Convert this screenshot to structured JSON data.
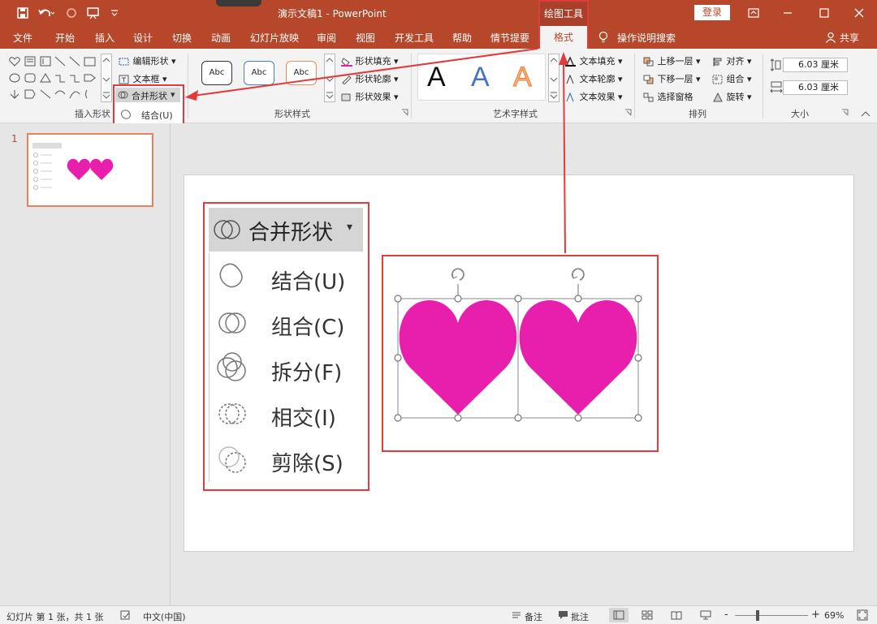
{
  "titlebar": {
    "title": "演示文稿1 - PowerPoint",
    "drawing_tools": "绘图工具",
    "login": "登录"
  },
  "tabs": [
    "文件",
    "开始",
    "插入",
    "设计",
    "切换",
    "动画",
    "幻灯片放映",
    "审阅",
    "视图",
    "开发工具",
    "帮助",
    "情节提要",
    "格式"
  ],
  "tell_me": "操作说明搜索",
  "share": "共享",
  "ribbon": {
    "insert_shapes": {
      "edit_shape": "编辑形状",
      "text_box": "文本框",
      "merge_shapes": "合并形状",
      "label": "插入形状"
    },
    "shape_styles": {
      "sample": "Abc",
      "fill": "形状填充",
      "outline": "形状轮廓",
      "effects": "形状效果",
      "label": "形状样式"
    },
    "wordart": {
      "letter": "A",
      "text_fill": "文本填充",
      "text_outline": "文本轮廓",
      "text_effects": "文本效果",
      "label": "艺术字样式"
    },
    "arrange": {
      "bring_forward": "上移一层",
      "send_backward": "下移一层",
      "selection_pane": "选择窗格",
      "align": "对齐",
      "group": "组合",
      "rotate": "旋转",
      "label": "排列"
    },
    "size": {
      "height": "6.03 厘米",
      "width": "6.03 厘米",
      "label": "大小"
    }
  },
  "merge_menu": {
    "title": "合并形状",
    "items": [
      "结合(U)",
      "组合(C)",
      "拆分(F)",
      "相交(I)",
      "剪除(S)"
    ]
  },
  "thumbnail": {
    "number": "1"
  },
  "status": {
    "slide_info": "幻灯片 第 1 张，共 1 张",
    "language": "中文(中国)",
    "notes": "备注",
    "comments": "批注",
    "zoom": "69%",
    "minus": "-",
    "plus": "+"
  },
  "colors": {
    "accent": "#b7472a",
    "heart": "#e81fad",
    "highlight": "#e03c3c"
  }
}
